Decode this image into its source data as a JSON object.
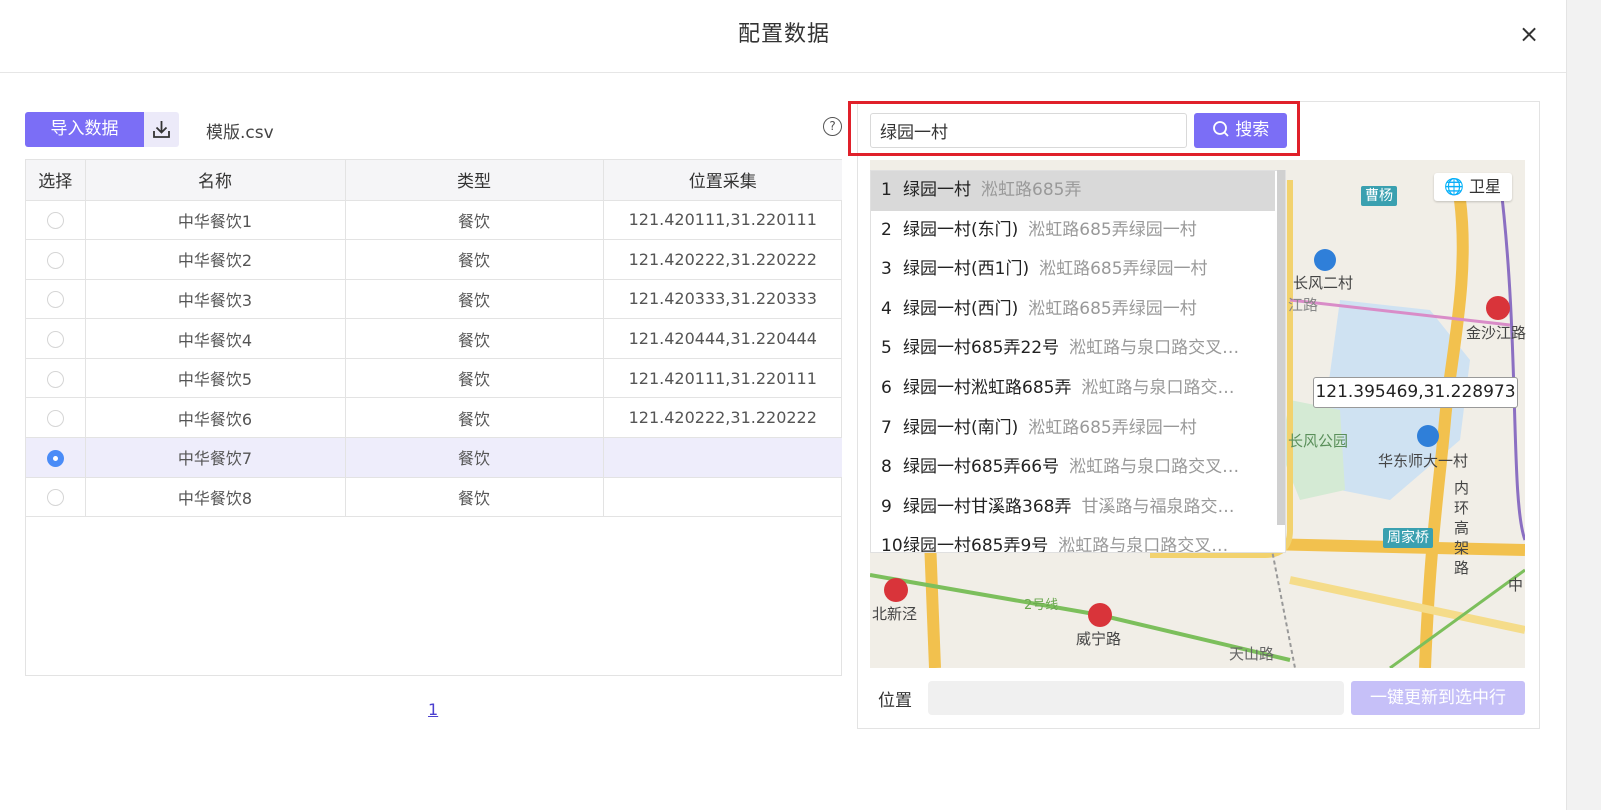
{
  "dialog": {
    "title": "配置数据",
    "close_label": "×"
  },
  "toolbar": {
    "import_label": "导入数据",
    "download_icon": "download-icon",
    "template_label": "模版.csv",
    "help_label": "?"
  },
  "table": {
    "headers": [
      "选择",
      "名称",
      "类型",
      "位置采集"
    ],
    "rows": [
      {
        "name": "中华餐饮1",
        "type": "餐饮",
        "location": "121.420111,31.220111",
        "selected": false
      },
      {
        "name": "中华餐饮2",
        "type": "餐饮",
        "location": "121.420222,31.220222",
        "selected": false
      },
      {
        "name": "中华餐饮3",
        "type": "餐饮",
        "location": "121.420333,31.220333",
        "selected": false
      },
      {
        "name": "中华餐饮4",
        "type": "餐饮",
        "location": "121.420444,31.220444",
        "selected": false
      },
      {
        "name": "中华餐饮5",
        "type": "餐饮",
        "location": "121.420111,31.220111",
        "selected": false
      },
      {
        "name": "中华餐饮6",
        "type": "餐饮",
        "location": "121.420222,31.220222",
        "selected": false
      },
      {
        "name": "中华餐饮7",
        "type": "餐饮",
        "location": "",
        "selected": true
      },
      {
        "name": "中华餐饮8",
        "type": "餐饮",
        "location": "",
        "selected": false
      }
    ]
  },
  "pagination": {
    "current_page": "1"
  },
  "map_search": {
    "query": "绿园一村",
    "button_label": "搜索",
    "suggestions": [
      {
        "index": "1",
        "name": "绿园一村",
        "address": "淞虹路685弄"
      },
      {
        "index": "2",
        "name": "绿园一村(东门)",
        "address": "淞虹路685弄绿园一村"
      },
      {
        "index": "3",
        "name": "绿园一村(西1门)",
        "address": "淞虹路685弄绿园一村"
      },
      {
        "index": "4",
        "name": "绿园一村(西门)",
        "address": "淞虹路685弄绿园一村"
      },
      {
        "index": "5",
        "name": "绿园一村685弄22号",
        "address": "淞虹路与泉口路交叉…"
      },
      {
        "index": "6",
        "name": "绿园一村淞虹路685弄",
        "address": "淞虹路与泉口路交…"
      },
      {
        "index": "7",
        "name": "绿园一村(南门)",
        "address": "淞虹路685弄绿园一村"
      },
      {
        "index": "8",
        "name": "绿园一村685弄66号",
        "address": "淞虹路与泉口路交叉…"
      },
      {
        "index": "9",
        "name": "绿园一村甘溪路368弄",
        "address": "甘溪路与福泉路交…"
      },
      {
        "index": "10",
        "name": "绿园一村685弄9号",
        "address": "淞虹路与泉口路交叉…"
      }
    ]
  },
  "map": {
    "satellite_label": "卫星",
    "coordinate_tooltip": "121.395469,31.228973",
    "labels": {
      "caoyang": "曹杨",
      "changfeng_ercun": "长风二村",
      "jiang_road": "江路",
      "jinshajiang": "金沙江路",
      "changfeng_park": "长风公园",
      "huadong_shida": "华东师大一村",
      "neihuan": "内环高架路",
      "zhoujiaqiao": "周家桥",
      "beixinjing": "北新泾",
      "line2": "2号线",
      "weining_road": "威宁路",
      "tianshan_road": "天山路",
      "zhong": "中"
    }
  },
  "position": {
    "label": "位置",
    "value": "",
    "update_button_label": "一键更新到选中行"
  }
}
